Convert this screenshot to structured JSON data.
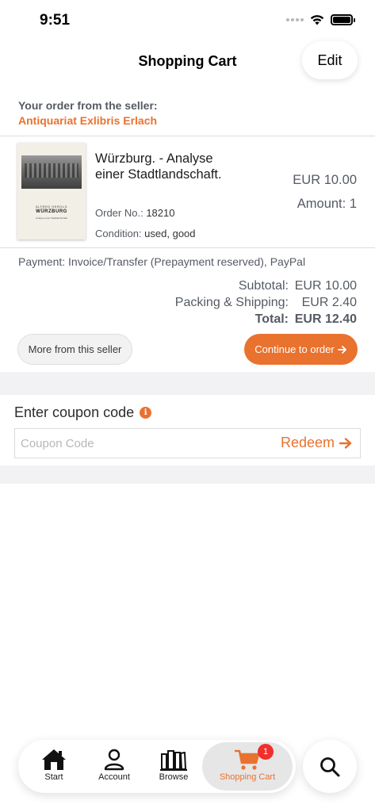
{
  "status_bar": {
    "time": "9:51"
  },
  "nav": {
    "title": "Shopping Cart",
    "edit_label": "Edit"
  },
  "seller": {
    "caption": "Your order from the seller:",
    "name": "Antiquariat Exlibris Erlach"
  },
  "item": {
    "title": "Würzburg. - Analyse einer Stadtlandschaft.",
    "order_no_label": "Order No.:",
    "order_no": "18210",
    "condition_label": "Condition:",
    "condition": "used, good",
    "price": "EUR 10.00",
    "amount_label": "Amount:",
    "amount": "1",
    "cover": {
      "author": "ALFRED HEROLD",
      "title": "WÜRZBURG",
      "subtitle": "Analyse einer Stadtlandschaft"
    }
  },
  "payment": {
    "text": "Payment: Invoice/Transfer (Prepayment reserved), PayPal"
  },
  "totals": [
    {
      "label": "Subtotal:",
      "value": "EUR 10.00",
      "bold": false
    },
    {
      "label": "Packing & Shipping:",
      "value": "EUR 2.40",
      "bold": false
    },
    {
      "label": "Total:",
      "value": "EUR 12.40",
      "bold": true
    }
  ],
  "actions": {
    "more_label": "More from this seller",
    "continue_label": "Continue to order"
  },
  "coupon": {
    "title": "Enter coupon code",
    "placeholder": "Coupon Code",
    "redeem_label": "Redeem"
  },
  "tab_bar": {
    "tabs": [
      {
        "label": "Start",
        "icon": "home-icon",
        "active": false
      },
      {
        "label": "Account",
        "icon": "person-icon",
        "active": false
      },
      {
        "label": "Browse",
        "icon": "books-icon",
        "active": false
      },
      {
        "label": "Shopping Cart",
        "icon": "cart-icon",
        "active": true,
        "badge": "1"
      }
    ],
    "search_icon": "search-icon"
  },
  "colors": {
    "accent": "#e9722f",
    "badge": "#f0302c",
    "muted_text": "#555a63",
    "background_band": "#f2f2f4"
  }
}
